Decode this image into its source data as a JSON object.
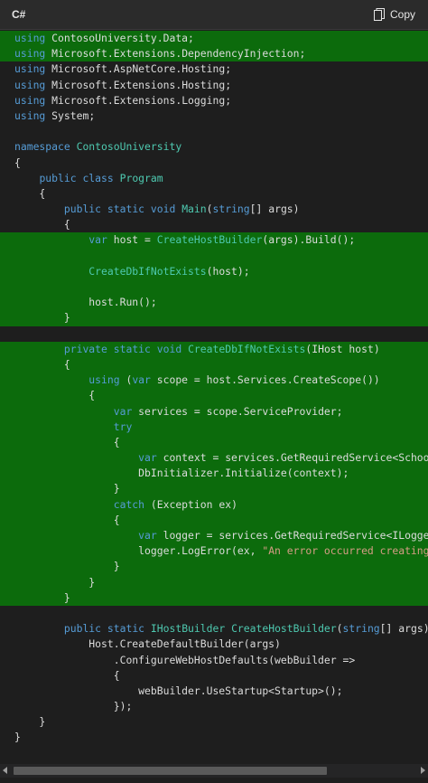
{
  "header": {
    "language": "C#",
    "copy_label": "Copy"
  },
  "code": {
    "lines": [
      {
        "text": "using ContosoUniversity.Data;",
        "highlight": true
      },
      {
        "text": "using Microsoft.Extensions.DependencyInjection;",
        "highlight": true
      },
      {
        "text": "using Microsoft.AspNetCore.Hosting;",
        "highlight": false
      },
      {
        "text": "using Microsoft.Extensions.Hosting;",
        "highlight": false
      },
      {
        "text": "using Microsoft.Extensions.Logging;",
        "highlight": false
      },
      {
        "text": "using System;",
        "highlight": false
      },
      {
        "text": "",
        "highlight": false
      },
      {
        "text": "namespace ContosoUniversity",
        "highlight": false
      },
      {
        "text": "{",
        "highlight": false
      },
      {
        "text": "    public class Program",
        "highlight": false
      },
      {
        "text": "    {",
        "highlight": false
      },
      {
        "text": "        public static void Main(string[] args)",
        "highlight": false
      },
      {
        "text": "        {",
        "highlight": false
      },
      {
        "text": "            var host = CreateHostBuilder(args).Build();",
        "highlight": true
      },
      {
        "text": "",
        "highlight": true
      },
      {
        "text": "            CreateDbIfNotExists(host);",
        "highlight": true
      },
      {
        "text": "",
        "highlight": true
      },
      {
        "text": "            host.Run();",
        "highlight": true
      },
      {
        "text": "        }",
        "highlight": true
      },
      {
        "text": "",
        "highlight": false
      },
      {
        "text": "        private static void CreateDbIfNotExists(IHost host)",
        "highlight": true
      },
      {
        "text": "        {",
        "highlight": true
      },
      {
        "text": "            using (var scope = host.Services.CreateScope())",
        "highlight": true
      },
      {
        "text": "            {",
        "highlight": true
      },
      {
        "text": "                var services = scope.ServiceProvider;",
        "highlight": true
      },
      {
        "text": "                try",
        "highlight": true
      },
      {
        "text": "                {",
        "highlight": true
      },
      {
        "text": "                    var context = services.GetRequiredService<SchoolContext>();",
        "highlight": true
      },
      {
        "text": "                    DbInitializer.Initialize(context);",
        "highlight": true
      },
      {
        "text": "                }",
        "highlight": true
      },
      {
        "text": "                catch (Exception ex)",
        "highlight": true
      },
      {
        "text": "                {",
        "highlight": true
      },
      {
        "text": "                    var logger = services.GetRequiredService<ILogger<Program>>();",
        "highlight": true
      },
      {
        "text": "                    logger.LogError(ex, \"An error occurred creating the DB.\");",
        "highlight": true
      },
      {
        "text": "                }",
        "highlight": true
      },
      {
        "text": "            }",
        "highlight": true
      },
      {
        "text": "        }",
        "highlight": true
      },
      {
        "text": "",
        "highlight": false
      },
      {
        "text": "        public static IHostBuilder CreateHostBuilder(string[] args) =>",
        "highlight": false
      },
      {
        "text": "            Host.CreateDefaultBuilder(args)",
        "highlight": false
      },
      {
        "text": "                .ConfigureWebHostDefaults(webBuilder =>",
        "highlight": false
      },
      {
        "text": "                {",
        "highlight": false
      },
      {
        "text": "                    webBuilder.UseStartup<Startup>();",
        "highlight": false
      },
      {
        "text": "                });",
        "highlight": false
      },
      {
        "text": "    }",
        "highlight": false
      },
      {
        "text": "}",
        "highlight": false
      }
    ]
  },
  "colors": {
    "background": "#1e1e1e",
    "highlight": "#0c6b0c",
    "keyword": "#569cd6",
    "type": "#4ec9b0",
    "string": "#d69d85",
    "text": "#dcdcdc"
  },
  "icons": {
    "copy": "copy-icon"
  }
}
